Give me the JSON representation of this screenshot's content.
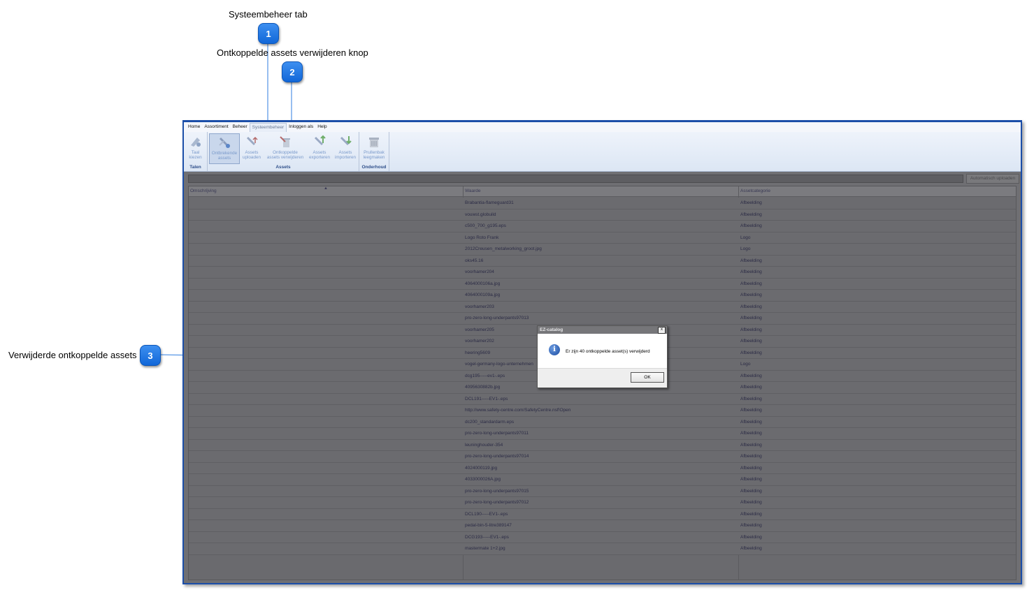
{
  "callouts": [
    {
      "number": "1",
      "label": "Systeembeheer tab"
    },
    {
      "number": "2",
      "label": "Ontkoppelde assets verwijderen knop"
    },
    {
      "number": "3",
      "label": "Verwijderde ontkoppelde assets"
    }
  ],
  "menu": [
    "Home",
    "Assortiment",
    "Beheer",
    "Systeembeheer",
    "Inloggen als",
    "Help"
  ],
  "ribbon": {
    "groups": [
      {
        "caption": "Talen",
        "buttons": [
          {
            "label1": "Taal",
            "label2": "kiezen"
          }
        ]
      },
      {
        "caption": "Assets",
        "buttons": [
          {
            "label1": "Ontbrekende",
            "label2": "assets"
          },
          {
            "label1": "Assets",
            "label2": "uploaden"
          },
          {
            "label1": "Ontkoppelde",
            "label2": "assets verwijderen"
          },
          {
            "label1": "Assets",
            "label2": "exporteren"
          },
          {
            "label1": "Assets",
            "label2": "importeren"
          }
        ]
      },
      {
        "caption": "Onderhoud",
        "buttons": [
          {
            "label1": "Prullenbak",
            "label2": "leegmaken"
          }
        ]
      }
    ]
  },
  "auto_upload_label": "Automatisch uploaden",
  "grid": {
    "columns": [
      "Omschrijving",
      "Waarde",
      "Assetcategorie"
    ],
    "rows": [
      [
        "",
        "Brabantia-flameguard31",
        "Afbeelding"
      ],
      [
        "",
        "vouwst.globuild",
        "Afbeelding"
      ],
      [
        "",
        "c500_700_g195.eps",
        "Afbeelding"
      ],
      [
        "",
        "Logo Roto Frank",
        "Logo"
      ],
      [
        "",
        "2012Creusen_metalworking_groot.jpg",
        "Logo"
      ],
      [
        "",
        "oks45.16",
        "Afbeelding"
      ],
      [
        "",
        "voorhamer204",
        "Afbeelding"
      ],
      [
        "",
        "4064000106a.jpg",
        "Afbeelding"
      ],
      [
        "",
        "4064000109a.jpg",
        "Afbeelding"
      ],
      [
        "",
        "voorhamer203",
        "Afbeelding"
      ],
      [
        "",
        "pro-zero-long-underpants97013",
        "Afbeelding"
      ],
      [
        "",
        "voorhamer205",
        "Afbeelding"
      ],
      [
        "",
        "voorhamer202",
        "Afbeelding"
      ],
      [
        "",
        "heering5609",
        "Afbeelding"
      ],
      [
        "",
        "vogel-germany-logo-unternehmen",
        "Logo"
      ],
      [
        "",
        "dcg195-----ev1-.eps",
        "Afbeelding"
      ],
      [
        "",
        "4095630882b.jpg",
        "Afbeelding"
      ],
      [
        "",
        "DCL191-----EV1-.eps",
        "Afbeelding"
      ],
      [
        "",
        "http://www.safety-centre.com/SafetyCentre.nsf!Open",
        "Afbeelding"
      ],
      [
        "",
        "dc200_standardarm.eps",
        "Afbeelding"
      ],
      [
        "",
        "pro-zero-long-underpants97011",
        "Afbeelding"
      ],
      [
        "",
        "leuninghouder-354",
        "Afbeelding"
      ],
      [
        "",
        "pro-zero-long-underpants97014",
        "Afbeelding"
      ],
      [
        "",
        "4024000119.jpg",
        "Afbeelding"
      ],
      [
        "",
        "4033000026A.jpg",
        "Afbeelding"
      ],
      [
        "",
        "pro-zero-long-underpants97015",
        "Afbeelding"
      ],
      [
        "",
        "pro-zero-long-underpants97012",
        "Afbeelding"
      ],
      [
        "",
        "DCL190-----EV1-.eps",
        "Afbeelding"
      ],
      [
        "",
        "pedal-bin-5-litre389147",
        "Afbeelding"
      ],
      [
        "",
        "DCG193-----EV1-.eps",
        "Afbeelding"
      ],
      [
        "",
        "mastermate 1+2.jpg",
        "Afbeelding"
      ]
    ]
  },
  "dialog": {
    "title": "EZ-catalog",
    "close": "x",
    "message": "Er zijn 40 ontkoppelde asset(s) verwijderd",
    "ok_label": "OK"
  },
  "colors": {
    "badge": "#1a6fe0",
    "window_border": "#1b4ea8",
    "overlay": "#6f6f73"
  }
}
